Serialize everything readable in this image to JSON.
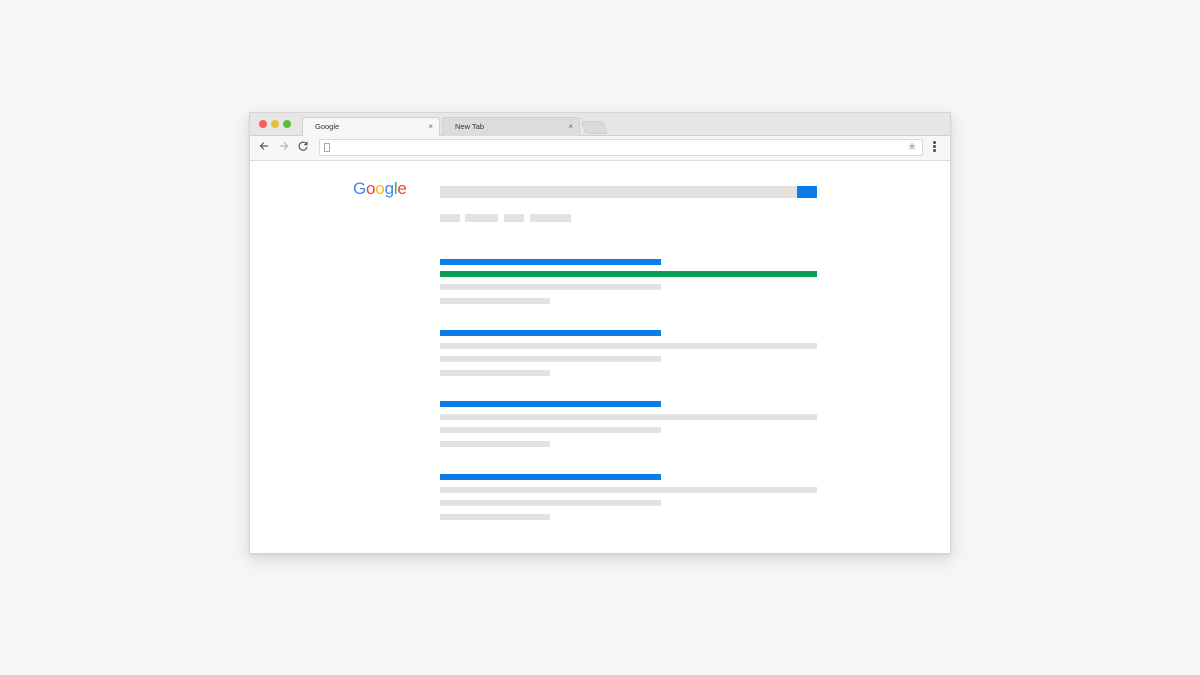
{
  "tabs": [
    {
      "label": "Google",
      "active": true
    },
    {
      "label": "New Tab",
      "active": false
    }
  ],
  "tab_close_glyph": "×",
  "toolbar": {
    "back_icon": "arrow-left-icon",
    "forward_icon": "arrow-right-icon",
    "reload_icon": "reload-icon",
    "star_icon": "star-icon",
    "menu_icon": "three-dots-menu-icon"
  },
  "logo": {
    "letters": [
      "G",
      "o",
      "o",
      "g",
      "l",
      "e"
    ],
    "colors": [
      "#4285f4",
      "#ea4335",
      "#fbbc05",
      "#4285f4",
      "#34a853",
      "#ea4335"
    ]
  },
  "colors": {
    "link": "#0c7ce8",
    "url": "#0d9d58",
    "placeholder": "#e2e2e2",
    "background": "#f6f6f7"
  }
}
